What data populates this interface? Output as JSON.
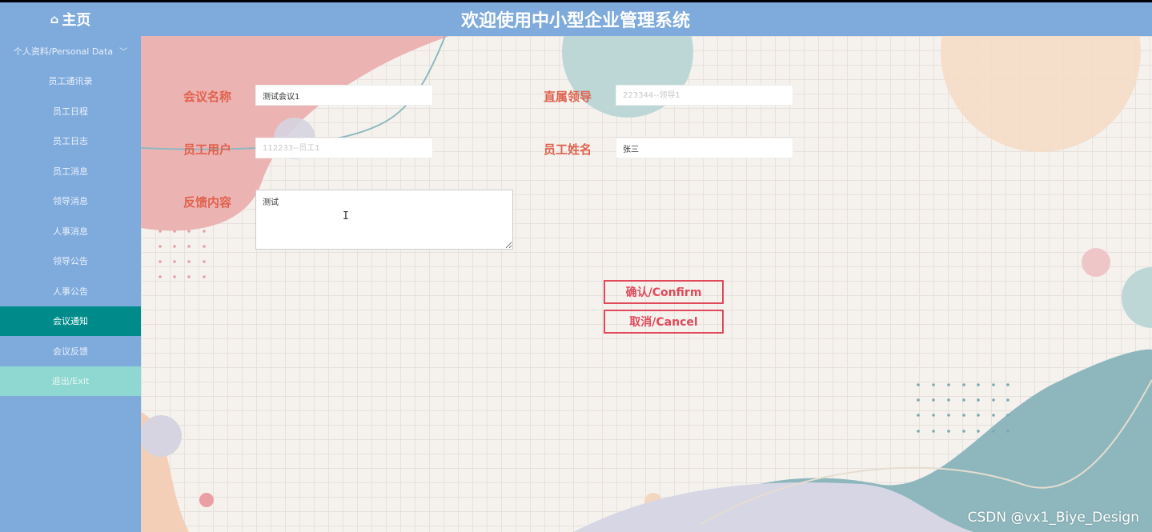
{
  "header": {
    "home_label": "主页",
    "home_icon": "home-icon",
    "title": "欢迎使用中小型企业管理系统"
  },
  "sidebar": {
    "items": [
      {
        "label": "个人资料/Personal Data",
        "type": "dropdown"
      },
      {
        "label": "员工通讯录"
      },
      {
        "label": "员工日程"
      },
      {
        "label": "员工日志"
      },
      {
        "label": "员工消息"
      },
      {
        "label": "领导消息"
      },
      {
        "label": "人事消息"
      },
      {
        "label": "领导公告"
      },
      {
        "label": "人事公告"
      },
      {
        "label": "会议通知",
        "active": true
      },
      {
        "label": "会议反馈"
      },
      {
        "label": "退出/Exit",
        "type": "exit"
      }
    ]
  },
  "form": {
    "meeting_name": {
      "label": "会议名称",
      "value": "测试会议1"
    },
    "direct_leader": {
      "label": "直属领导",
      "placeholder": "223344--领导1"
    },
    "employee_user": {
      "label": "员工用户",
      "placeholder": "112233--员工1"
    },
    "employee_name": {
      "label": "员工姓名",
      "value": "张三"
    },
    "feedback": {
      "label": "反馈内容",
      "value": "测试"
    },
    "confirm_label": "确认/Confirm",
    "cancel_label": "取消/Cancel"
  },
  "watermark": "CSDN @vx1_Biye_Design",
  "colors": {
    "header_bg": "#7faadc",
    "sidebar_active": "#008b8b",
    "sidebar_exit": "#8ed8d1",
    "label_color": "#e0614c",
    "button_color": "#e04a5a"
  }
}
